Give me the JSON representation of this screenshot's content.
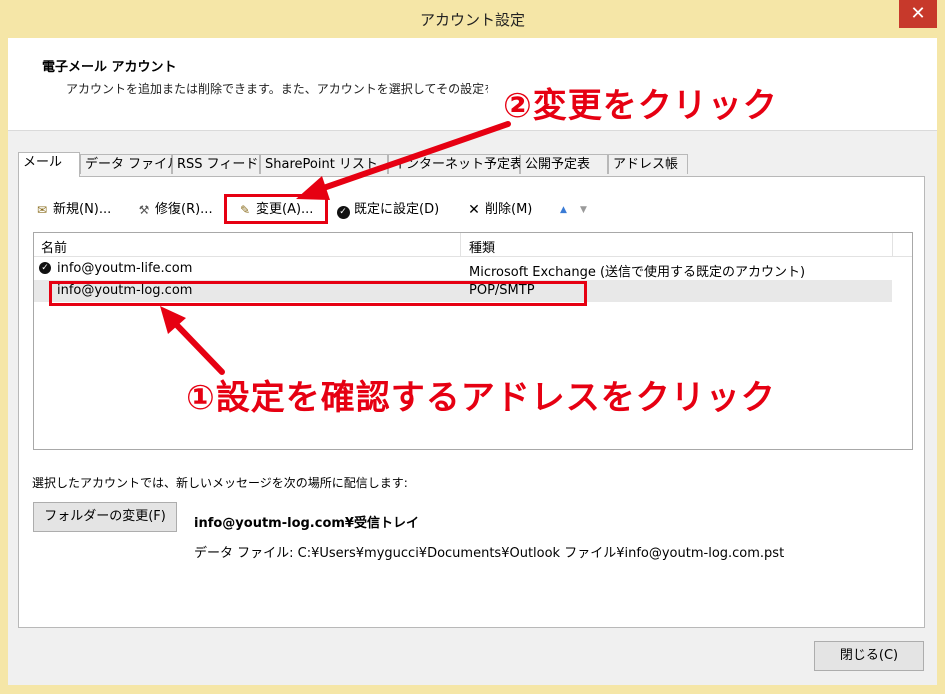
{
  "window": {
    "title": "アカウント設定",
    "close_glyph": "✕"
  },
  "header": {
    "title": "電子メール アカウント",
    "description": "アカウントを追加または削除できます。また、アカウントを選択してその設定を変更できます。"
  },
  "tabs": [
    {
      "label": "メール"
    },
    {
      "label": "データ ファイル"
    },
    {
      "label": "RSS フィード"
    },
    {
      "label": "SharePoint リスト"
    },
    {
      "label": "インターネット予定表"
    },
    {
      "label": "公開予定表"
    },
    {
      "label": "アドレス帳"
    }
  ],
  "toolbar": {
    "new_label": "新規(N)...",
    "repair_label": "修復(R)...",
    "change_label": "変更(A)...",
    "set_default_label": "既定に設定(D)",
    "delete_label": "削除(M)",
    "up_glyph": "▲",
    "down_glyph": "▼"
  },
  "list": {
    "columns": [
      "名前",
      "種類"
    ],
    "rows": [
      {
        "name": "info@youtm-life.com",
        "type": "Microsoft Exchange (送信で使用する既定のアカウント)",
        "default": true
      },
      {
        "name": "info@youtm-log.com",
        "type": "POP/SMTP",
        "default": false
      }
    ]
  },
  "delivery": {
    "status_text": "選択したアカウントでは、新しいメッセージを次の場所に配信します:",
    "folder_button": "フォルダーの変更(F)",
    "target": "info@youtm-log.com¥受信トレイ",
    "data_file": "データ ファイル: C:¥Users¥mygucci¥Documents¥Outlook ファイル¥info@youtm-log.com.pst"
  },
  "footer": {
    "close_label": "閉じる(C)"
  },
  "annotations": {
    "step2": "②変更をクリック",
    "step1": "①設定を確認するアドレスをクリック"
  },
  "colors": {
    "highlight": "#e60012",
    "titlebar": "#f5e6a7",
    "close_button": "#c7392b"
  }
}
